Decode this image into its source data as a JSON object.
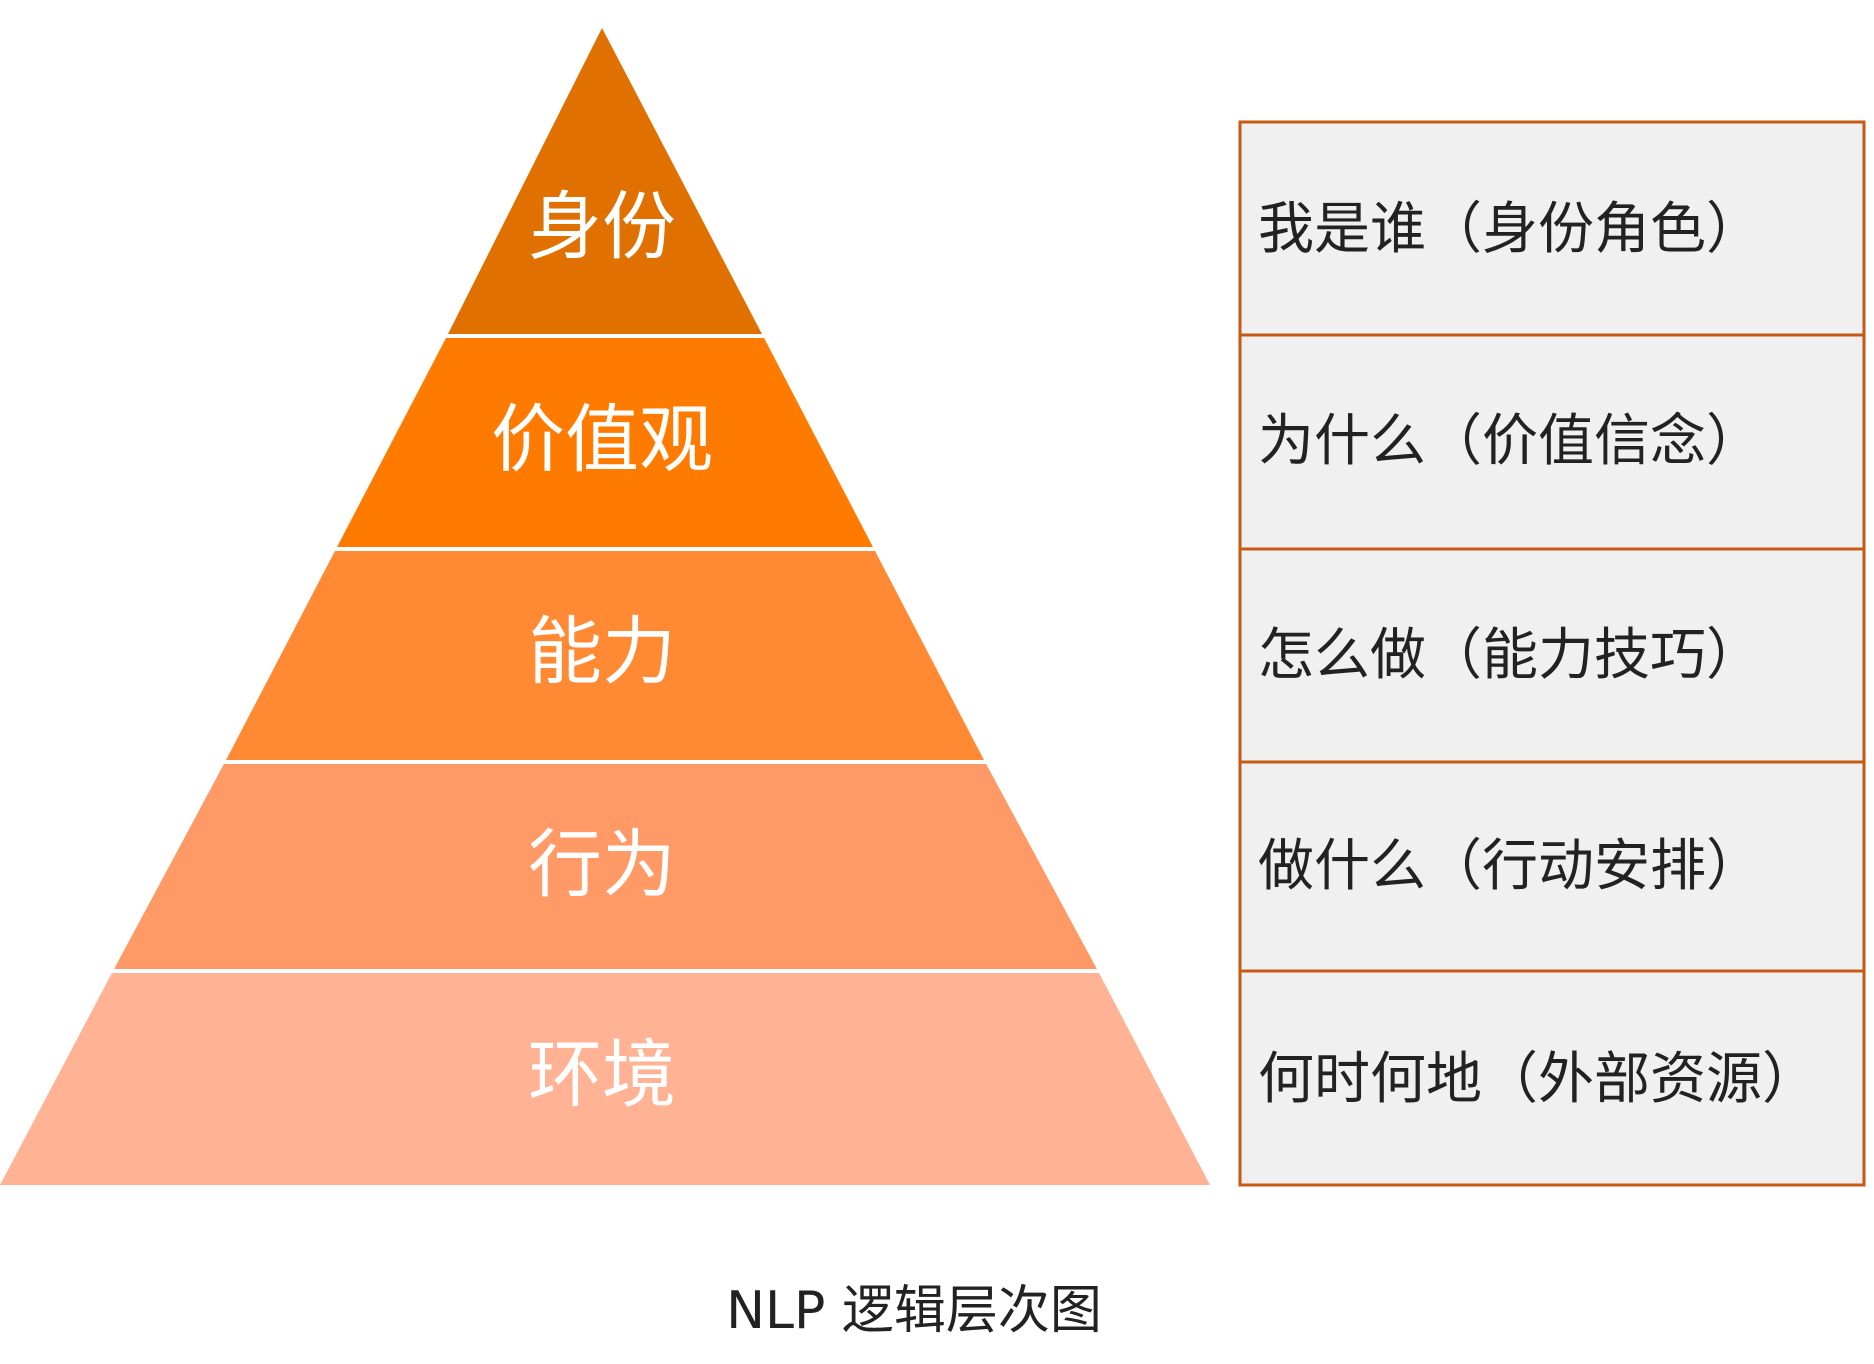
{
  "colors": {
    "layers": [
      "#E07000",
      "#FF7B00",
      "#FF8A33",
      "#FF9966",
      "#FFB294"
    ],
    "box_fill": "#F0F0F0",
    "box_border": "#C65A12"
  },
  "layers": [
    {
      "label": "身份",
      "description": "我是谁（身份角色）"
    },
    {
      "label": "价值观",
      "description": "为什么（价值信念）"
    },
    {
      "label": "能力",
      "description": "怎么做（能力技巧）"
    },
    {
      "label": "行为",
      "description": "做什么（行动安排）"
    },
    {
      "label": "环境",
      "description": "何时何地（外部资源）"
    }
  ],
  "caption": "NLP 逻辑层次图"
}
